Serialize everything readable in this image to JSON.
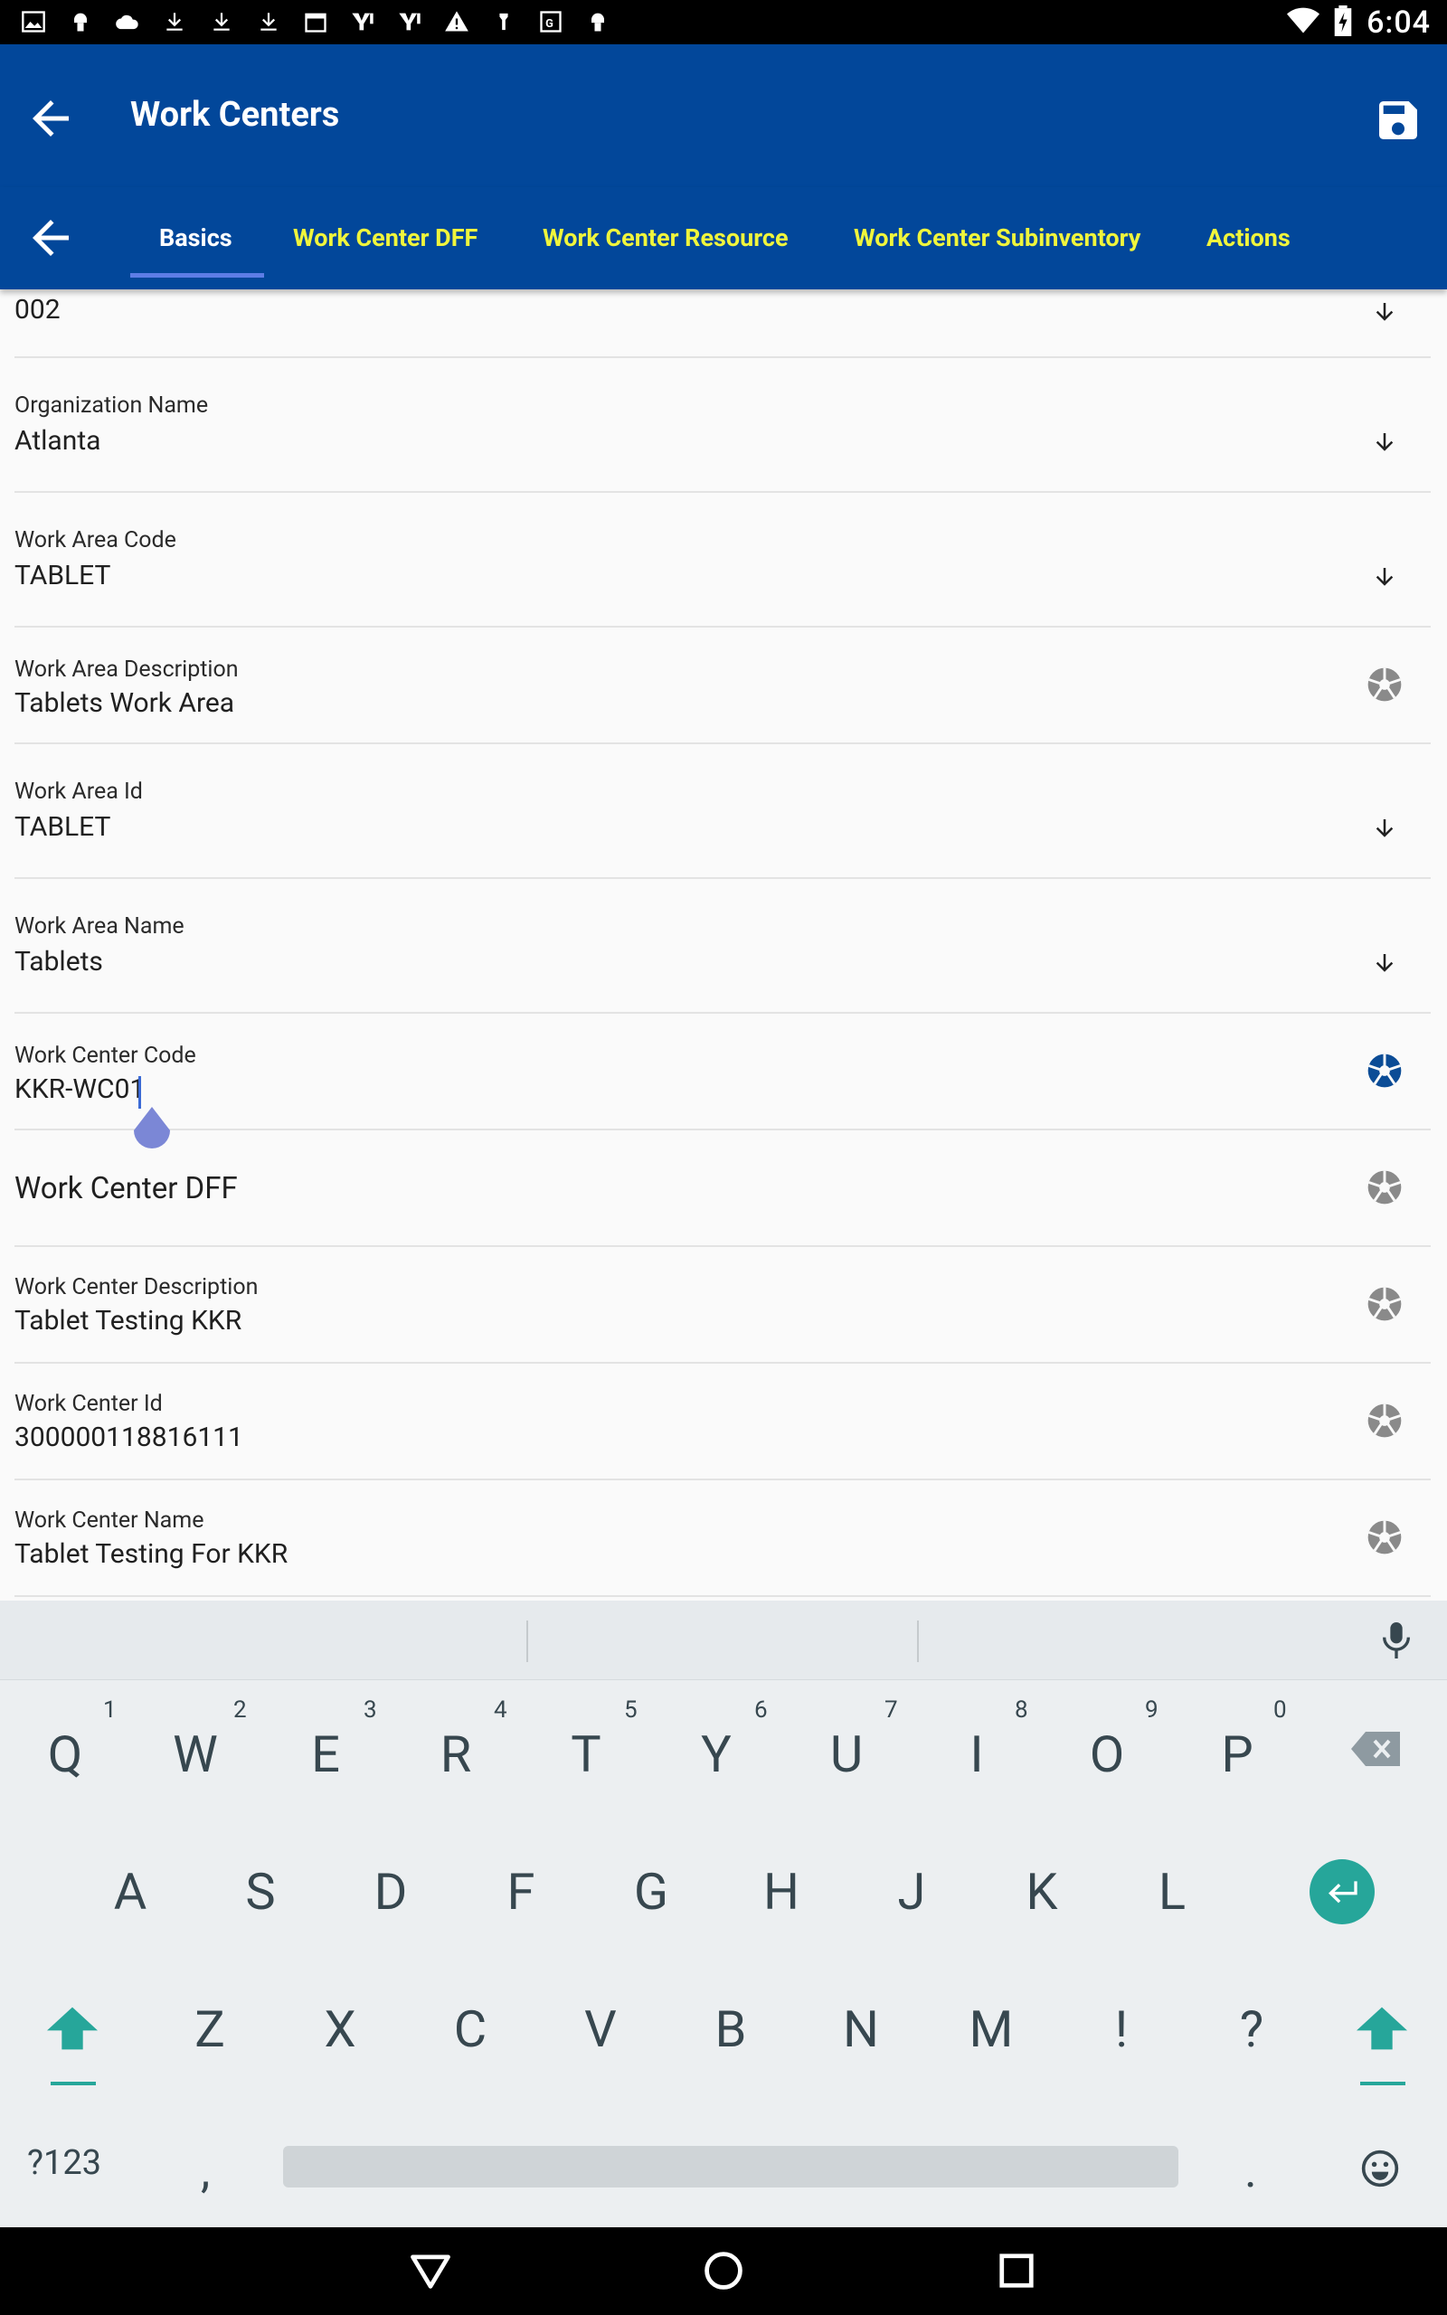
{
  "status_bar": {
    "time": "6:04",
    "left_icons": [
      "gallery-icon",
      "android-icon",
      "cloud-icon",
      "download-icon",
      "download-icon",
      "download-icon",
      "calendar-icon",
      "yahoo-icon",
      "yahoo-icon",
      "warning-icon",
      "flashlight-icon",
      "image-icon",
      "android-icon"
    ],
    "right_icons": [
      "wifi-icon",
      "battery-icon"
    ]
  },
  "app_bar": {
    "title": "Work Centers",
    "back_icon": "arrow-left-icon",
    "save_icon": "save-icon"
  },
  "tabs": [
    {
      "label": "Basics",
      "active": true
    },
    {
      "label": "Work Center DFF",
      "active": false
    },
    {
      "label": "Work Center Resource",
      "active": false
    },
    {
      "label": "Work Center Subinventory",
      "active": false
    },
    {
      "label": "Actions",
      "active": false
    }
  ],
  "fields": [
    {
      "label": "",
      "value": "002",
      "icon": "arrow-down-icon"
    },
    {
      "label": "Organization Name",
      "value": "Atlanta",
      "icon": "arrow-down-icon"
    },
    {
      "label": "Work Area Code",
      "value": "TABLET",
      "icon": "arrow-down-icon"
    },
    {
      "label": "Work Area Description",
      "value": "Tablets Work Area",
      "icon": "aperture-icon"
    },
    {
      "label": "Work Area Id",
      "value": "TABLET",
      "icon": "arrow-down-icon"
    },
    {
      "label": "Work Area Name",
      "value": "Tablets",
      "icon": "arrow-down-icon"
    },
    {
      "label": "Work Center Code",
      "value": "KKR-WC01",
      "icon": "aperture-icon",
      "focused": true
    },
    {
      "label": "",
      "value": "Work Center DFF",
      "icon": "aperture-icon"
    },
    {
      "label": "Work Center Description",
      "value": "Tablet Testing KKR",
      "icon": "aperture-icon"
    },
    {
      "label": "Work Center Id",
      "value": "300000118816111",
      "icon": "aperture-icon"
    },
    {
      "label": "Work Center Name",
      "value": "Tablet Testing For KKR",
      "icon": "aperture-icon"
    }
  ],
  "keyboard": {
    "row1": [
      "Q",
      "W",
      "E",
      "R",
      "T",
      "Y",
      "U",
      "I",
      "O",
      "P"
    ],
    "row1_hints": [
      "1",
      "2",
      "3",
      "4",
      "5",
      "6",
      "7",
      "8",
      "9",
      "0"
    ],
    "row2": [
      "A",
      "S",
      "D",
      "F",
      "G",
      "H",
      "J",
      "K",
      "L"
    ],
    "row3": [
      "Z",
      "X",
      "C",
      "V",
      "B",
      "N",
      "M",
      "!",
      "?"
    ],
    "symbols_label": "?123",
    "comma": ",",
    "period": ".",
    "accent_color": "#26a69a"
  },
  "colors": {
    "app_bar": "#02479a",
    "tab_inactive": "#f0f53c",
    "tab_active": "#ffffff"
  }
}
